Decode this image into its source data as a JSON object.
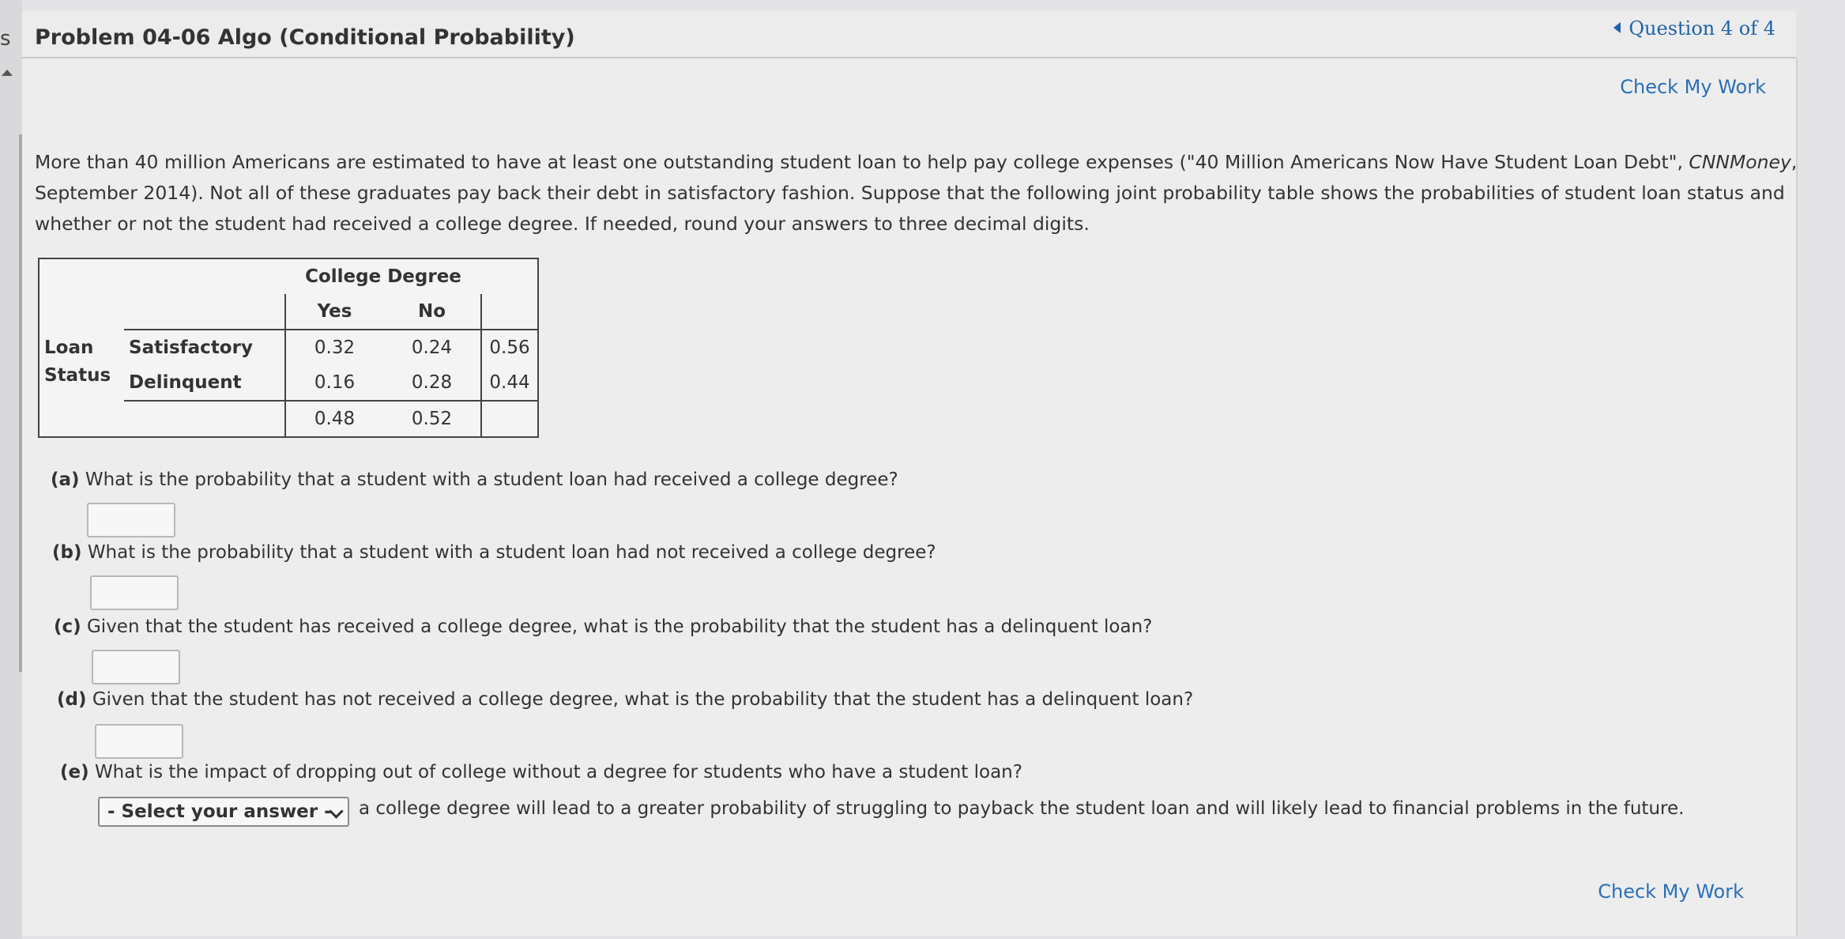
{
  "left_rail": {
    "letter": "s"
  },
  "header": {
    "title": "Problem 04-06 Algo (Conditional Probability)",
    "question_nav": "Question 4 of 4"
  },
  "check_my_work_top": "Check My Work",
  "check_my_work_bottom": "Check My Work",
  "intro": {
    "part1": "More than 40 million Americans are estimated to have at least one outstanding student loan to help pay college expenses (\"40 Million Americans Now Have Student Loan Debt\", ",
    "source": "CNNMoney",
    "part2": ", September 2014). Not all of these graduates pay back their debt in satisfactory fashion. Suppose that the following joint probability table shows the probabilities of student loan status and whether or not the student had received a college degree. If needed, round your answers to three decimal digits."
  },
  "table": {
    "col_group": "College Degree",
    "col_yes": "Yes",
    "col_no": "No",
    "row_group_line1": "Loan",
    "row_group_line2": "Status",
    "rows": [
      {
        "label": "Satisfactory",
        "yes": "0.32",
        "no": "0.24",
        "total": "0.56"
      },
      {
        "label": "Delinquent",
        "yes": "0.16",
        "no": "0.28",
        "total": "0.44"
      }
    ],
    "totals": {
      "yes": "0.48",
      "no": "0.52"
    }
  },
  "questions": [
    {
      "tag": "(a)",
      "text": "What is the probability that a student with a student loan had received a college degree?"
    },
    {
      "tag": "(b)",
      "text": "What is the probability that a student with a student loan had not received a college degree?"
    },
    {
      "tag": "(c)",
      "text": "Given that the student has received a college degree, what is the probability that the student has a delinquent loan?"
    },
    {
      "tag": "(d)",
      "text": "Given that the student has not received a college degree, what is the probability that the student has a delinquent loan?"
    },
    {
      "tag": "(e)",
      "text": "What is the impact of dropping out of college without a degree for students who have a student loan?"
    }
  ],
  "answer_e": {
    "select_value": "- Select your answer -",
    "rest": "a college degree will lead to a greater probability of struggling to payback the student loan and will likely lead to financial problems in the future."
  }
}
